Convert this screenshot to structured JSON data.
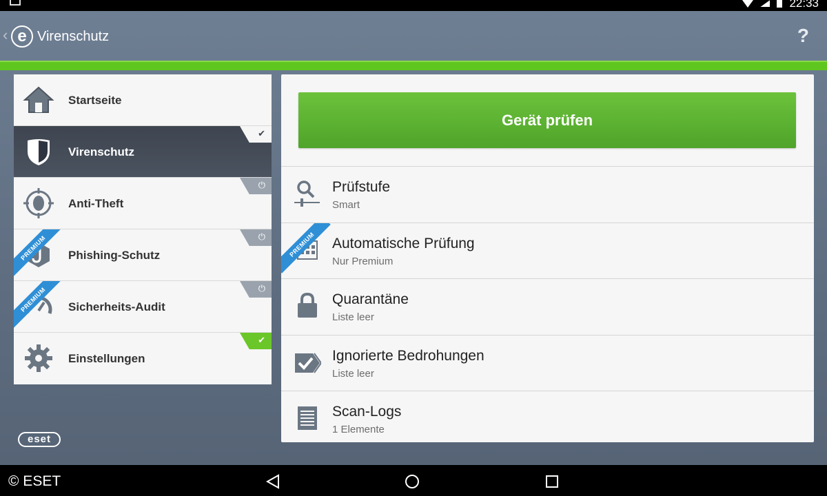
{
  "statusbar": {
    "time": "22:33"
  },
  "appbar": {
    "title": "Virenschutz",
    "help": "?"
  },
  "sidebar": {
    "items": [
      {
        "label": "Startseite",
        "icon": "home-icon"
      },
      {
        "label": "Virenschutz",
        "icon": "shield-icon",
        "active": true
      },
      {
        "label": "Anti-Theft",
        "icon": "crosshair-icon"
      },
      {
        "label": "Phishing-Schutz",
        "icon": "hook-icon",
        "premium": "PREMIUM"
      },
      {
        "label": "Sicherheits-Audit",
        "icon": "gauge-icon",
        "premium": "PREMIUM"
      },
      {
        "label": "Einstellungen",
        "icon": "gear-icon"
      }
    ],
    "logo": "eset"
  },
  "main": {
    "scan_button": "Gerät prüfen",
    "rows": [
      {
        "title": "Prüfstufe",
        "subtitle": "Smart",
        "icon": "magnifier-slider-icon"
      },
      {
        "title": "Automatische Prüfung",
        "subtitle": "Nur Premium",
        "icon": "calendar-icon",
        "premium": "PREMIUM"
      },
      {
        "title": "Quarantäne",
        "subtitle": "Liste leer",
        "icon": "lock-icon"
      },
      {
        "title": "Ignorierte Bedrohungen",
        "subtitle": "Liste leer",
        "icon": "checked-tag-icon"
      },
      {
        "title": "Scan-Logs",
        "subtitle": "1 Elemente",
        "icon": "document-list-icon"
      }
    ]
  },
  "footer": {
    "copyright": "© ESET"
  },
  "colors": {
    "accent_green": "#5fc61f",
    "premium_blue": "#2f8fd6",
    "active_dark": "#3e4550"
  }
}
